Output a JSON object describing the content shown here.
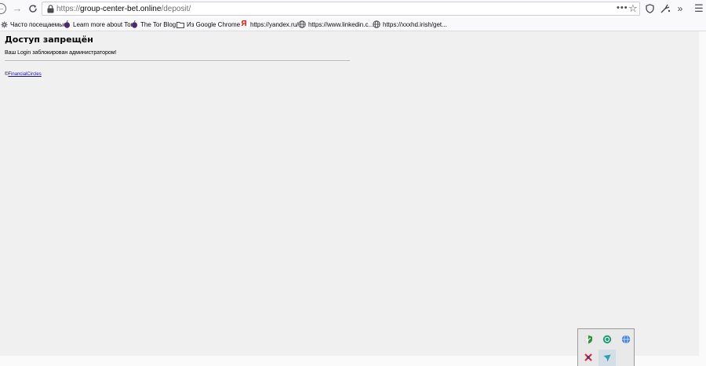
{
  "toolbar": {
    "url_scheme": "https://",
    "url_host": "group-center-bet.online",
    "url_path": "/deposit/",
    "page_actions_glyph": "•••",
    "star_glyph": "☆",
    "overflow_glyph": "»",
    "menu_glyph": "☰",
    "back_glyph": "←",
    "forward_glyph": "→",
    "reload_glyph": "C"
  },
  "bookmarks": [
    {
      "label": "Часто посещаемые",
      "icon": "gear-icon"
    },
    {
      "label": "Learn more about Tor",
      "icon": "tor-onion-icon"
    },
    {
      "label": "The Tor Blog",
      "icon": "tor-onion-icon"
    },
    {
      "label": "Из Google Chrome",
      "icon": "folder-icon"
    },
    {
      "label": "https://yandex.ru/",
      "icon": "yandex-icon"
    },
    {
      "label": "https://www.linkedin.c...",
      "icon": "globe-icon"
    },
    {
      "label": "https://xxxhd.irish/get...",
      "icon": "globe-icon"
    }
  ],
  "page": {
    "title": "Доступ запрещён",
    "message": "Ваш Login заблокирован администратором!",
    "footer_symbol": "©",
    "footer_link": "FinancialCircles"
  },
  "tray": {
    "icons": [
      "shield-check-icon",
      "green-circle-icon",
      "blue-globe-icon",
      "red-network-icon",
      "cursor-tray-icon"
    ]
  },
  "colors": {
    "page_background": "#f0f0f0",
    "link": "#1a0dab",
    "toolbar_background": "#f9f9fb"
  }
}
